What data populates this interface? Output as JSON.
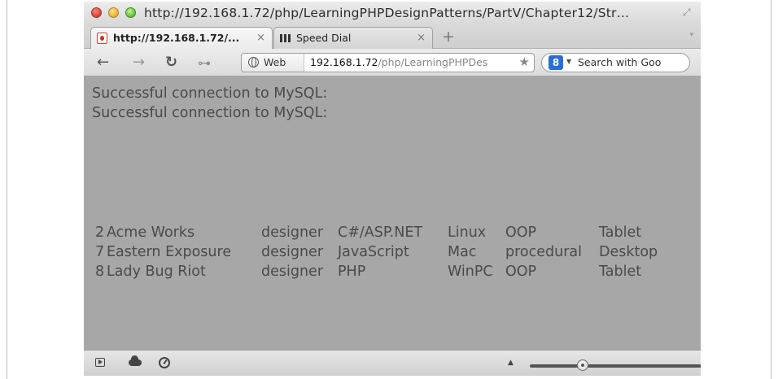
{
  "window": {
    "title": "http://192.168.1.72/php/LearningPHPDesignPatterns/PartV/Chapter12/Str…"
  },
  "tabs": [
    {
      "label": "http://192.168.1.72/...",
      "close": "×",
      "favicon": "page-icon"
    },
    {
      "label": "Speed Dial",
      "close": "×",
      "favicon": "grid-icon"
    }
  ],
  "tabbar": {
    "new_tab": "+",
    "menu": "▾"
  },
  "navbar": {
    "back": "←",
    "forward": "→",
    "reload": "↻",
    "key": "⊶",
    "url_prefix_label": "Web",
    "url_host": "192.168.1.72",
    "url_path": "/php/LearningPHPDes",
    "bookmark": "★",
    "search_engine_badge": "8",
    "search_placeholder": "Search with Goo"
  },
  "content": {
    "messages": [
      "Successful connection to MySQL:",
      "Successful connection to MySQL:"
    ],
    "rows": [
      [
        "2",
        "Acme Works",
        "designer",
        "C#/ASP.NET",
        "Linux",
        "OOP",
        "Tablet"
      ],
      [
        "7",
        "Eastern Exposure",
        "designer",
        "JavaScript",
        "Mac",
        "procedural",
        "Desktop"
      ],
      [
        "8",
        "Lady Bug Riot",
        "designer",
        "PHP",
        "WinPC",
        "OOP",
        "Tablet"
      ]
    ]
  },
  "bottombar": {
    "up_caret": "▲",
    "zoom_fraction": 0.3
  }
}
